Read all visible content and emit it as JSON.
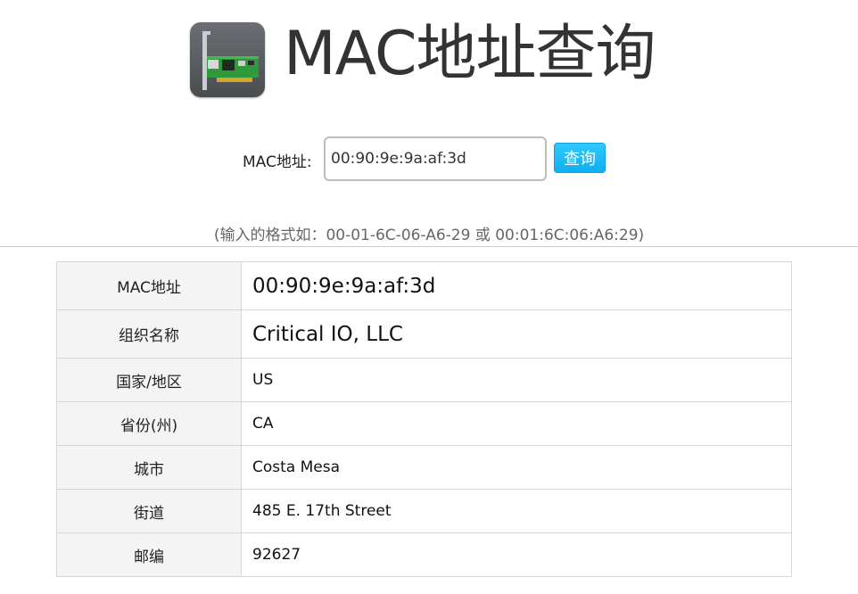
{
  "header": {
    "title": "MAC地址查询",
    "logo_icon": "network-card-icon"
  },
  "search": {
    "label": "MAC地址:",
    "value": "00:90:9e:9a:af:3d",
    "button_label": "查询",
    "accent_color": "#19b8f2"
  },
  "hint": "(输入的格式如：00-01-6C-06-A6-29 或 00:01:6C:06:A6:29)",
  "result": {
    "rows": [
      {
        "key": "MAC地址",
        "value": "00:90:9e:9a:af:3d"
      },
      {
        "key": "组织名称",
        "value": "Critical IO, LLC"
      },
      {
        "key": "国家/地区",
        "value": "US"
      },
      {
        "key": "省份(州)",
        "value": "CA"
      },
      {
        "key": "城市",
        "value": "Costa Mesa"
      },
      {
        "key": "街道",
        "value": "485 E. 17th Street"
      },
      {
        "key": "邮编",
        "value": "92627"
      }
    ]
  }
}
